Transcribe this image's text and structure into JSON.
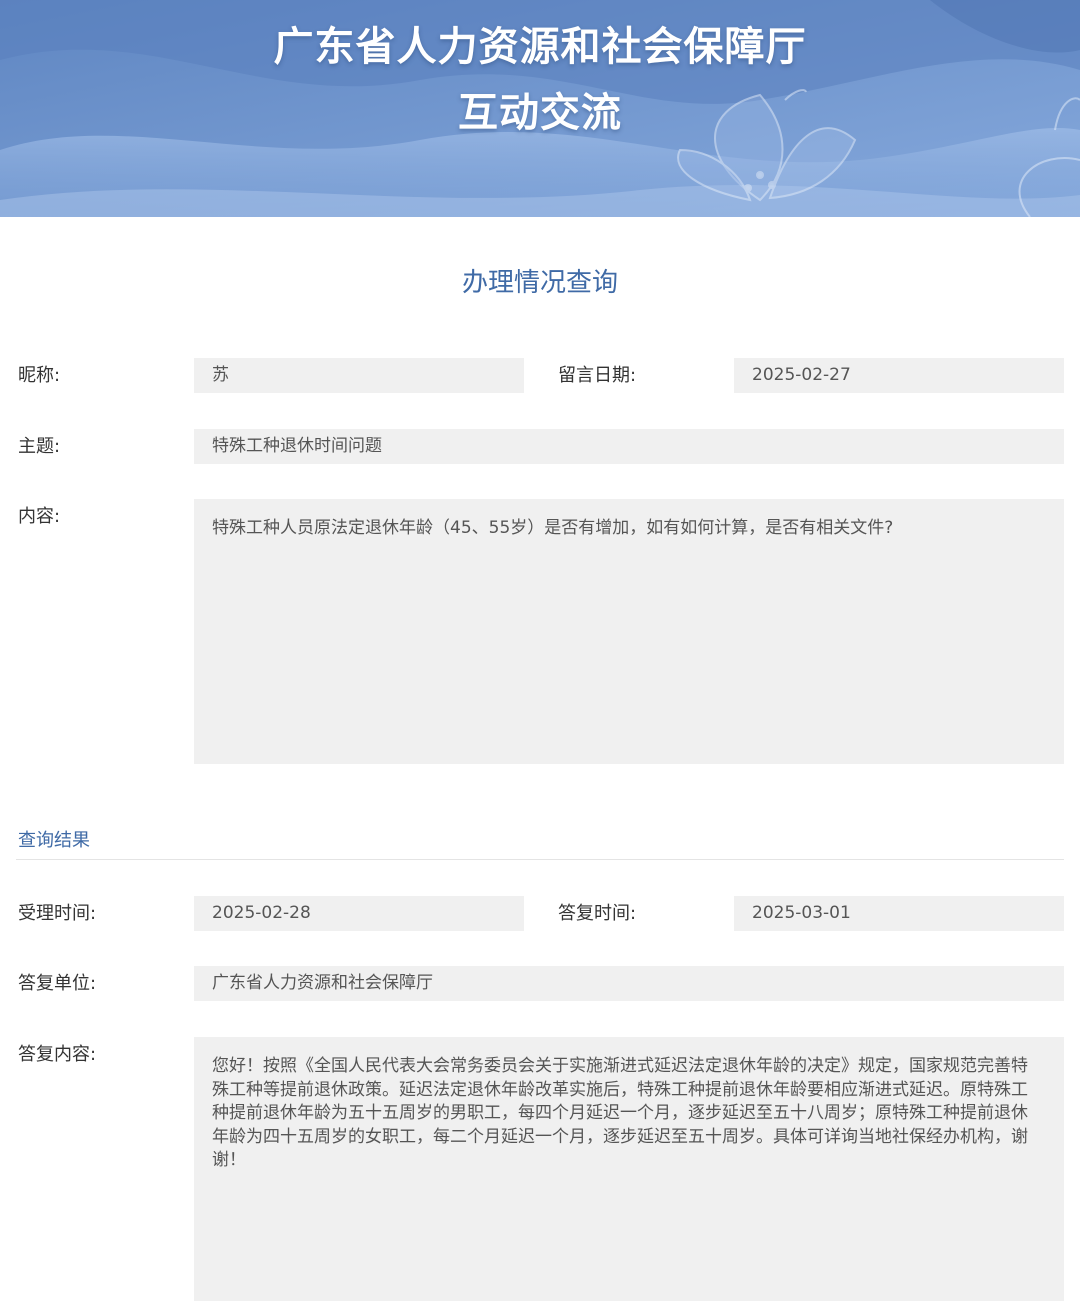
{
  "header": {
    "title_line1": "广东省人力资源和社会保障厅",
    "title_line2": "互动交流",
    "banner_color": "#6f97cf"
  },
  "page": {
    "title": "办理情况查询"
  },
  "message": {
    "nickname_label": "昵称:",
    "nickname_value": "苏",
    "date_label": "留言日期:",
    "date_value": "2025-02-27",
    "subject_label": "主题:",
    "subject_value": "特殊工种退休时间问题",
    "content_label": "内容:",
    "content_value": "特殊工种人员原法定退休年龄（45、55岁）是否有增加，如有如何计算，是否有相关文件?"
  },
  "result": {
    "section_title": "查询结果",
    "accept_time_label": "受理时间:",
    "accept_time_value": "2025-02-28",
    "reply_time_label": "答复时间:",
    "reply_time_value": "2025-03-01",
    "reply_unit_label": "答复单位:",
    "reply_unit_value": "广东省人力资源和社会保障厅",
    "reply_content_label": "答复内容:",
    "reply_content_value": "您好！按照《全国人民代表大会常务委员会关于实施渐进式延迟法定退休年龄的决定》规定，国家规范完善特殊工种等提前退休政策。延迟法定退休年龄改革实施后，特殊工种提前退休年龄要相应渐进式延迟。原特殊工种提前退休年龄为五十五周岁的男职工，每四个月延迟一个月，逐步延迟至五十八周岁；原特殊工种提前退休年龄为四十五周岁的女职工，每二个月延迟一个月，逐步延迟至五十周岁。具体可详询当地社保经办机构，谢谢！"
  },
  "icons": {
    "banner_decoration": "flower-icon"
  },
  "colors": {
    "accent": "#3f6aa6",
    "field_bg": "#f0f0f0"
  }
}
